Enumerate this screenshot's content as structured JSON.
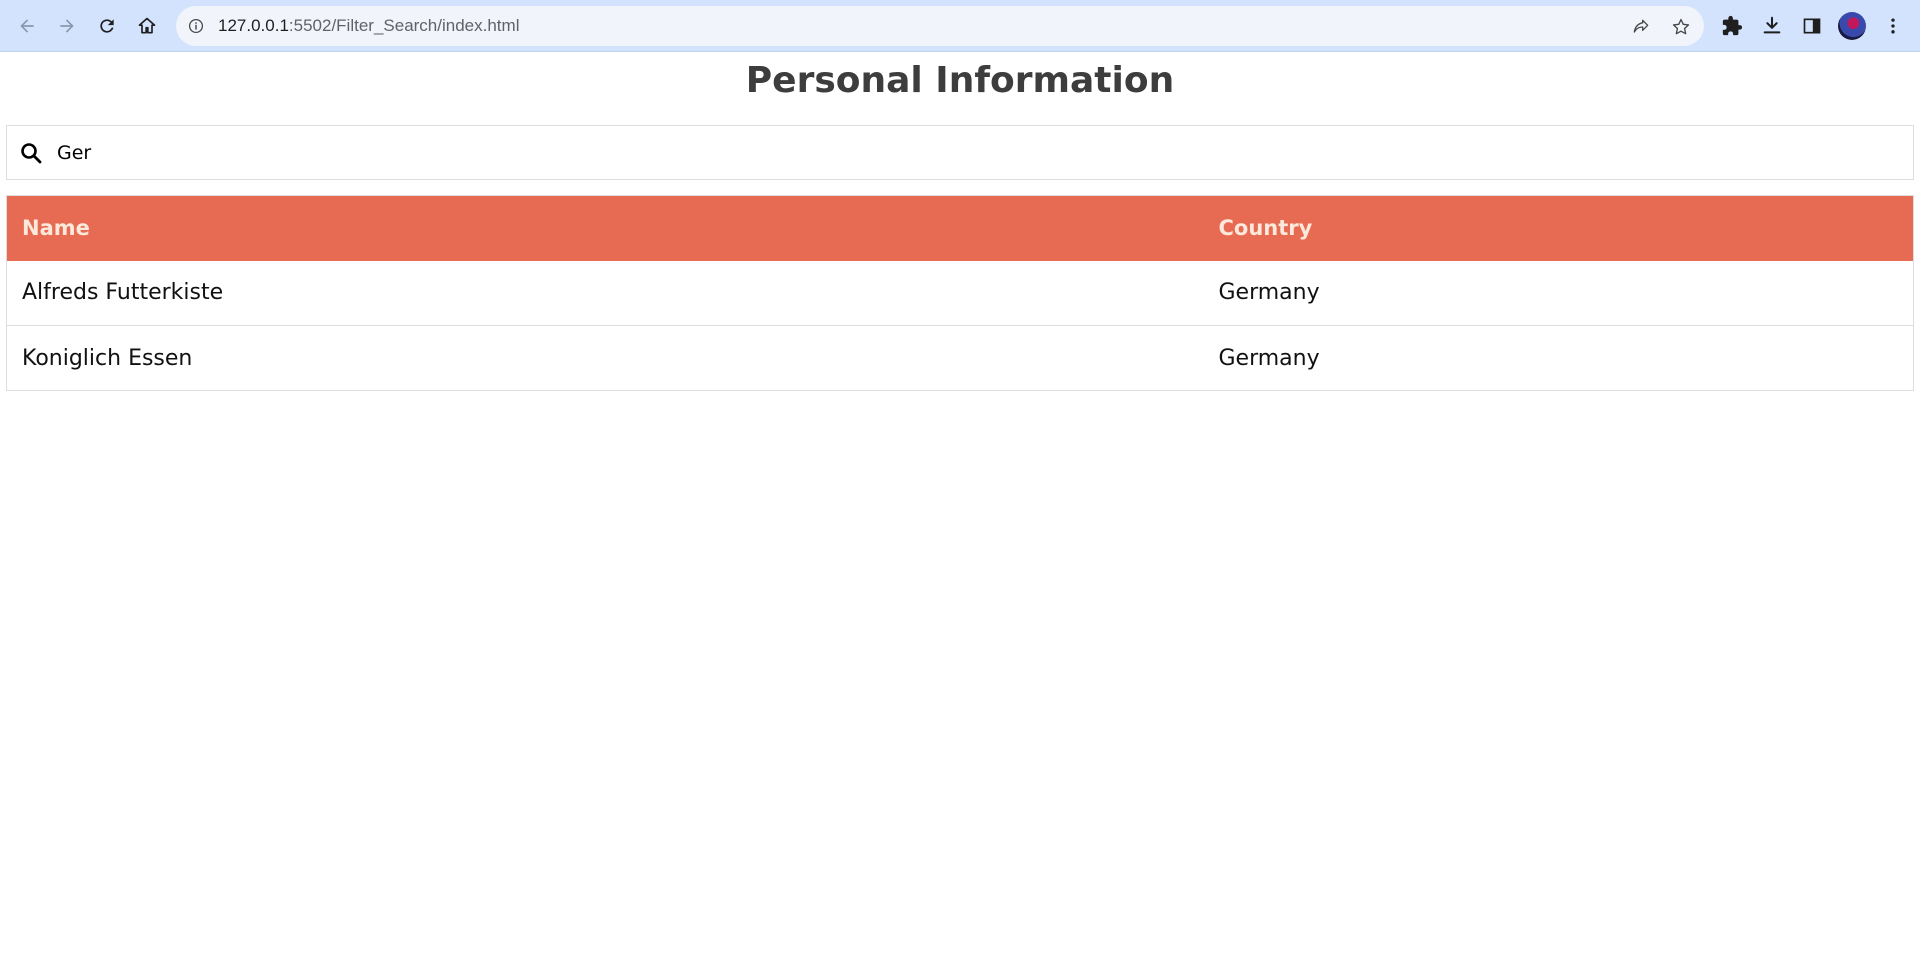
{
  "browser": {
    "url_host": "127.0.0.1",
    "url_path": ":5502/Filter_Search/index.html",
    "icons": {
      "back": "back-arrow-icon",
      "forward": "forward-arrow-icon",
      "reload": "reload-icon",
      "home": "home-icon",
      "site_info": "info-icon",
      "share": "share-icon",
      "bookmark": "star-icon",
      "extensions": "puzzle-icon",
      "downloads": "download-icon",
      "side_panel": "side-panel-icon",
      "menu": "kebab-menu-icon"
    }
  },
  "page": {
    "title": "Personal Information",
    "search": {
      "value": "Ger",
      "icon": "search-icon"
    },
    "table": {
      "header_color": "#e76a52",
      "columns": [
        "Name",
        "Country"
      ],
      "rows": [
        {
          "name": "Alfreds Futterkiste",
          "country": "Germany"
        },
        {
          "name": "Koniglich Essen",
          "country": "Germany"
        }
      ]
    }
  }
}
